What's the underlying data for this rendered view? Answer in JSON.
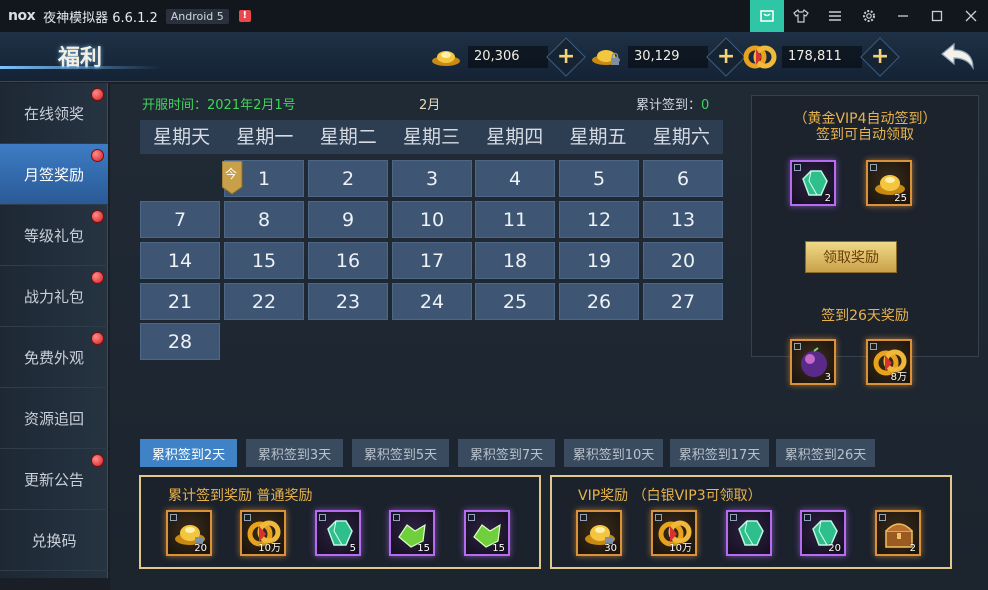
{
  "emulator": {
    "logo": "nox",
    "title": "夜神模拟器 6.6.1.2",
    "android_badge": "Android 5",
    "alert": "!",
    "buttons": [
      "store-icon",
      "shirt-icon",
      "menu-icon",
      "gear-icon",
      "minimize-icon",
      "maximize-icon",
      "close-icon"
    ]
  },
  "header": {
    "title": "福利",
    "currencies": [
      {
        "name": "gold-ingot",
        "value": "20,306"
      },
      {
        "name": "locked-gold-ingot",
        "value": "30,129"
      },
      {
        "name": "coin-string",
        "value": "178,811"
      }
    ],
    "plus": "+"
  },
  "sidebar": {
    "items": [
      {
        "label": "在线领奖",
        "dot": true,
        "active": false
      },
      {
        "label": "月签奖励",
        "dot": true,
        "active": true
      },
      {
        "label": "等级礼包",
        "dot": true,
        "active": false
      },
      {
        "label": "战力礼包",
        "dot": true,
        "active": false
      },
      {
        "label": "免费外观",
        "dot": true,
        "active": false
      },
      {
        "label": "资源追回",
        "dot": false,
        "active": false
      },
      {
        "label": "更新公告",
        "dot": true,
        "active": false
      },
      {
        "label": "兑换码",
        "dot": false,
        "active": false
      }
    ]
  },
  "calendar": {
    "open_time": "开服时间：2021年2月1号",
    "month": "2月",
    "total_label": "累计签到：",
    "total_value": "0",
    "weekdays": [
      "星期天",
      "星期一",
      "星期二",
      "星期三",
      "星期四",
      "星期五",
      "星期六"
    ],
    "days": [
      "1",
      "2",
      "3",
      "4",
      "5",
      "6",
      "7",
      "8",
      "9",
      "10",
      "11",
      "12",
      "13",
      "14",
      "15",
      "16",
      "17",
      "18",
      "19",
      "20",
      "21",
      "22",
      "23",
      "24",
      "25",
      "26",
      "27",
      "28"
    ],
    "today_tag": "今"
  },
  "vip_panel": {
    "line1": "（黄金VIP4自动签到）",
    "line2": "签到可自动领取",
    "auto_items": [
      {
        "icon": "green-gem-icon",
        "count": "2"
      },
      {
        "icon": "gold-ingot-icon",
        "count": "25"
      }
    ],
    "claim_label": "领取奖励",
    "day26_label": "签到26天奖励",
    "day26_items": [
      {
        "icon": "purple-orb-icon",
        "count": "3"
      },
      {
        "icon": "coin-string-icon",
        "count": "8万"
      }
    ]
  },
  "tabs": [
    "累积签到2天",
    "累积签到3天",
    "累积签到5天",
    "累积签到7天",
    "累积签到10天",
    "累积签到17天",
    "累积签到26天"
  ],
  "normal_rewards": {
    "title": "累计签到奖励  普通奖励",
    "items": [
      {
        "icon": "gold-ingot-icon",
        "count": "20"
      },
      {
        "icon": "coin-string-icon",
        "count": "10万"
      },
      {
        "icon": "green-gem-icon",
        "count": "5"
      },
      {
        "icon": "green-crystal-icon",
        "count": "15"
      },
      {
        "icon": "green-crystal-icon",
        "count": "15"
      }
    ]
  },
  "vip_rewards": {
    "title": "VIP奖励  （白银VIP3可领取）",
    "items": [
      {
        "icon": "gold-ingot-icon",
        "count": "30"
      },
      {
        "icon": "coin-string-icon",
        "count": "10万"
      },
      {
        "icon": "green-gem-icon",
        "count": ""
      },
      {
        "icon": "green-gem-icon",
        "count": "20"
      },
      {
        "icon": "treasure-chest-icon",
        "count": "2"
      }
    ]
  },
  "colors": {
    "accent_green": "#42d45a",
    "accent_gold": "#e8b34c",
    "active_blue": "#3f82c6"
  }
}
